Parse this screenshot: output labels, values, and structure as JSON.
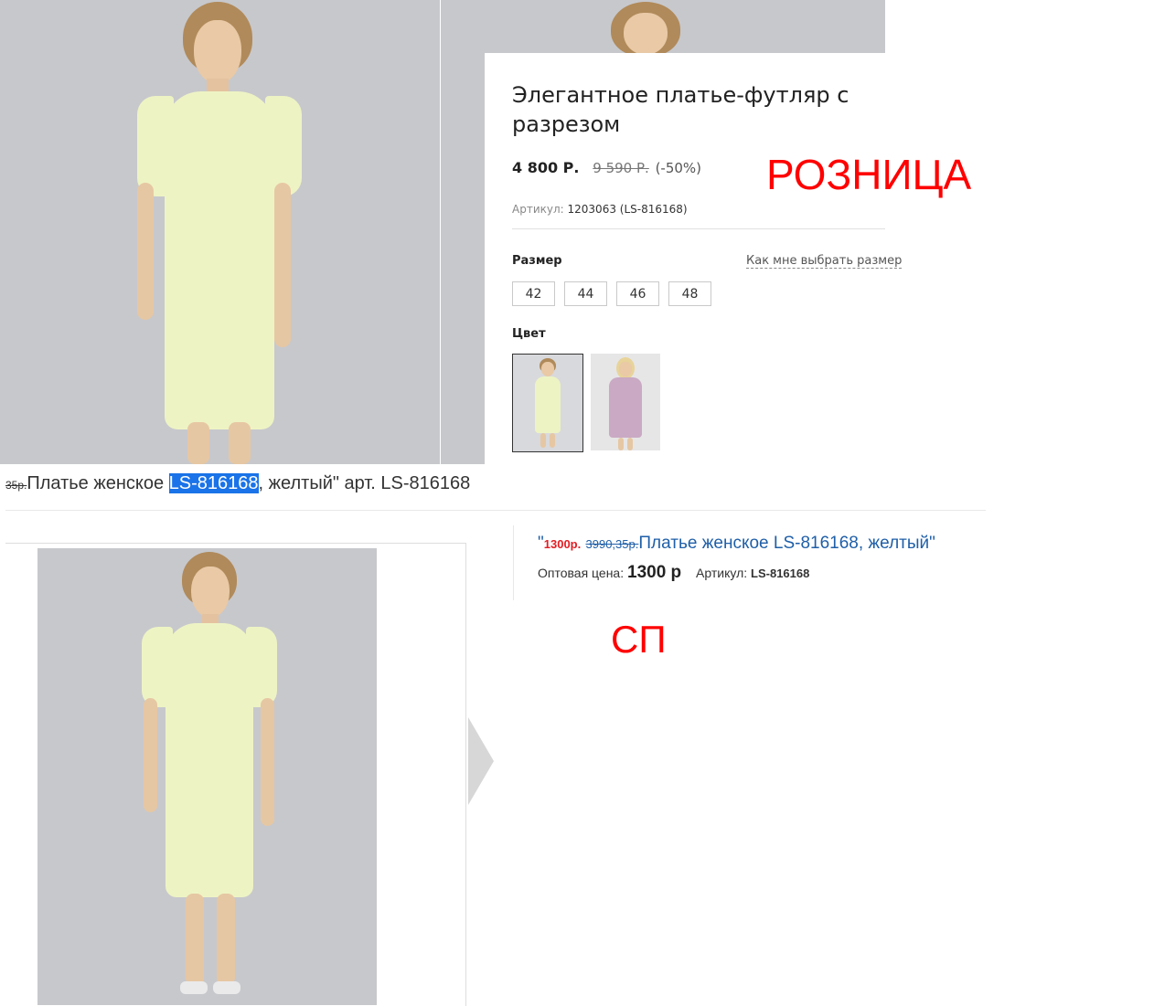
{
  "retail": {
    "title": "Элегантное платье-футляр с разрезом",
    "price_current": "4 800 Р.",
    "price_old": "9 590 Р.",
    "discount": "(-50%)",
    "article_label": "Артикул:",
    "article_value": "1203063 (LS-816168)",
    "size_label": "Размер",
    "size_help": "Как мне выбрать размер",
    "sizes": [
      "42",
      "44",
      "46",
      "48"
    ],
    "color_label": "Цвет",
    "colors": [
      "yellow",
      "lilac"
    ]
  },
  "labels": {
    "retail": "РОЗНИЦА",
    "sp": "СП"
  },
  "middle": {
    "struck": "35р.",
    "before": "Платье женское ",
    "highlight": "LS-816168",
    "after": ", желтый\" арт. LS-816168"
  },
  "sp": {
    "quote_open": "\"",
    "price_red": "1300р.",
    "price_old": "3990,35р.",
    "title": "Платье женское LS-816168, желтый\"",
    "wholesale_label": "Оптовая цена:",
    "wholesale_value": "1300 р",
    "article_label": "Артикул:",
    "article_value": "LS-816168"
  },
  "colors": {
    "accent_red": "#ff0000",
    "link_blue": "#1f5fa8",
    "highlight_blue": "#1a73e8",
    "photo_bg": "#c7c8cc"
  }
}
